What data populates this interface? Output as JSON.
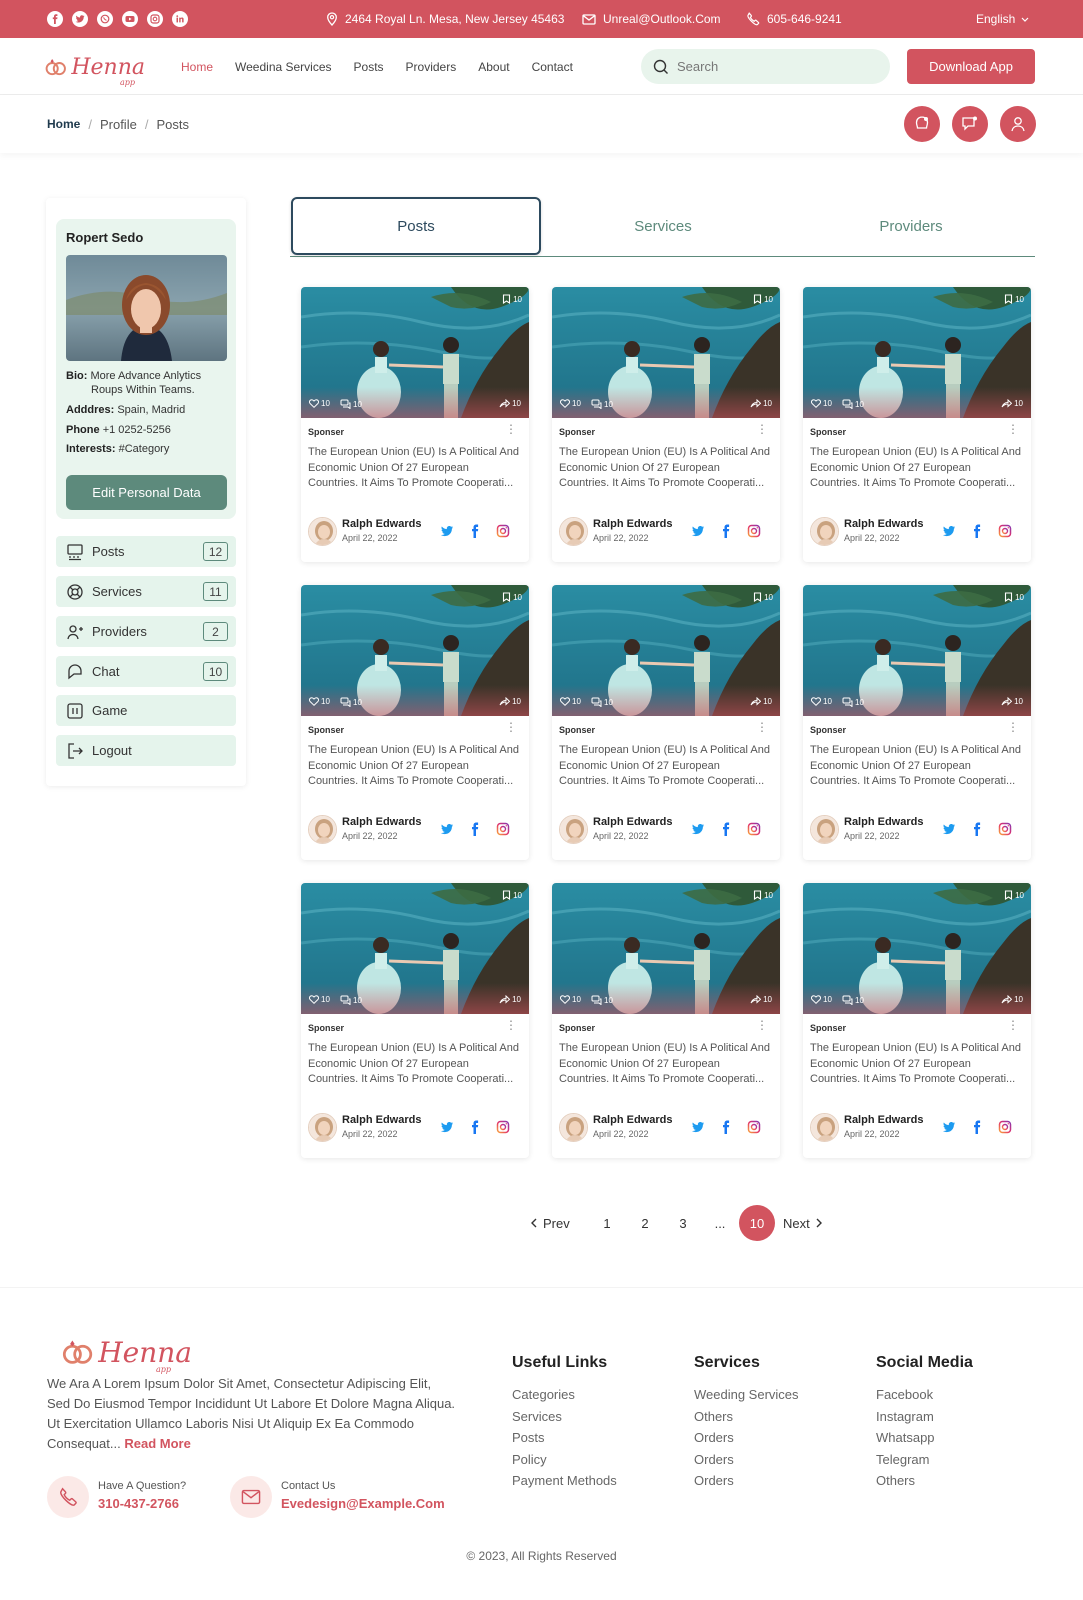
{
  "topbar": {
    "address": "2464 Royal Ln. Mesa, New Jersey 45463",
    "email": "Unreal@Outlook.Com",
    "phone": "605-646-9241",
    "language": "English",
    "socials": [
      "facebook-icon",
      "twitter-icon",
      "whatsapp-icon",
      "youtube-icon",
      "instagram-icon",
      "linkedin-icon"
    ]
  },
  "brand": {
    "name": "Henna",
    "suffix": "app",
    "color": "#d2545f"
  },
  "nav": {
    "items": [
      "Home",
      "Weedina Services",
      "Posts",
      "Providers",
      "About",
      "Contact"
    ],
    "active": "Home",
    "search_placeholder": "Search",
    "download_label": "Download App"
  },
  "breadcrumb": {
    "items": [
      "Home",
      "Profile",
      "Posts"
    ]
  },
  "profile": {
    "name": "Ropert Sedo",
    "bio_label": "Bio:",
    "bio_line1": "More Advance Anlytics",
    "bio_line2": "Roups Within Teams.",
    "address_label": "Adddres:",
    "address": "Spain, Madrid",
    "phone_label": "Phone",
    "phone": "+1 0252-5256",
    "interests_label": "Interests:",
    "interests": "#Category",
    "edit_label": "Edit Personal Data"
  },
  "sidebar": {
    "items": [
      {
        "label": "Posts",
        "count": "12",
        "icon": "posts-icon"
      },
      {
        "label": "Services",
        "count": "11",
        "icon": "services-icon"
      },
      {
        "label": "Providers",
        "count": "2",
        "icon": "providers-icon"
      },
      {
        "label": "Chat",
        "count": "10",
        "icon": "chat-icon"
      },
      {
        "label": "Game",
        "count": "",
        "icon": "game-icon"
      },
      {
        "label": "Logout",
        "count": "",
        "icon": "logout-icon"
      }
    ]
  },
  "tabs": {
    "items": [
      "Posts",
      "Services",
      "Providers"
    ],
    "active": "Posts"
  },
  "post": {
    "bookmarks": "10",
    "likes": "10",
    "comments": "10",
    "shares": "10",
    "tag": "Sponser",
    "description": "The European Union (EU) Is A Political And Economic Union Of 27 European Countries. It Aims To Promote Cooperati...",
    "author": "Ralph Edwards",
    "date": "April 22, 2022"
  },
  "pagination": {
    "prev": "Prev",
    "pages": [
      "1",
      "2",
      "3",
      "...",
      "10"
    ],
    "current": "10",
    "next": "Next"
  },
  "footer": {
    "description": "We Ara A Lorem Ipsum Dolor Sit Amet, Consectetur Adipiscing Elit, Sed Do Eiusmod Tempor Incididunt Ut Labore Et Dolore Magna Aliqua. Ut Exercitation Ullamco Laboris Nisi Ut Aliquip Ex Ea Commodo Consequat...",
    "read_more": "Read More",
    "question_label": "Have A Question?",
    "question_phone": "310-437-2766",
    "contact_label": "Contact Us",
    "contact_email": "Evedesign@Example.Com",
    "useful_links": {
      "title": "Useful Links",
      "items": [
        "Categories",
        "Services",
        "Posts",
        "Policy",
        "Payment Methods"
      ]
    },
    "services": {
      "title": "Services",
      "items": [
        "Weeding Services",
        "Others",
        "Orders",
        "Orders",
        "Orders"
      ]
    },
    "social_media": {
      "title": "Social Media",
      "items": [
        "Facebook",
        "Instagram",
        "Whatsapp",
        "Telegram",
        "Others"
      ]
    },
    "copyright": "© 2023, All Rights Reserved"
  }
}
